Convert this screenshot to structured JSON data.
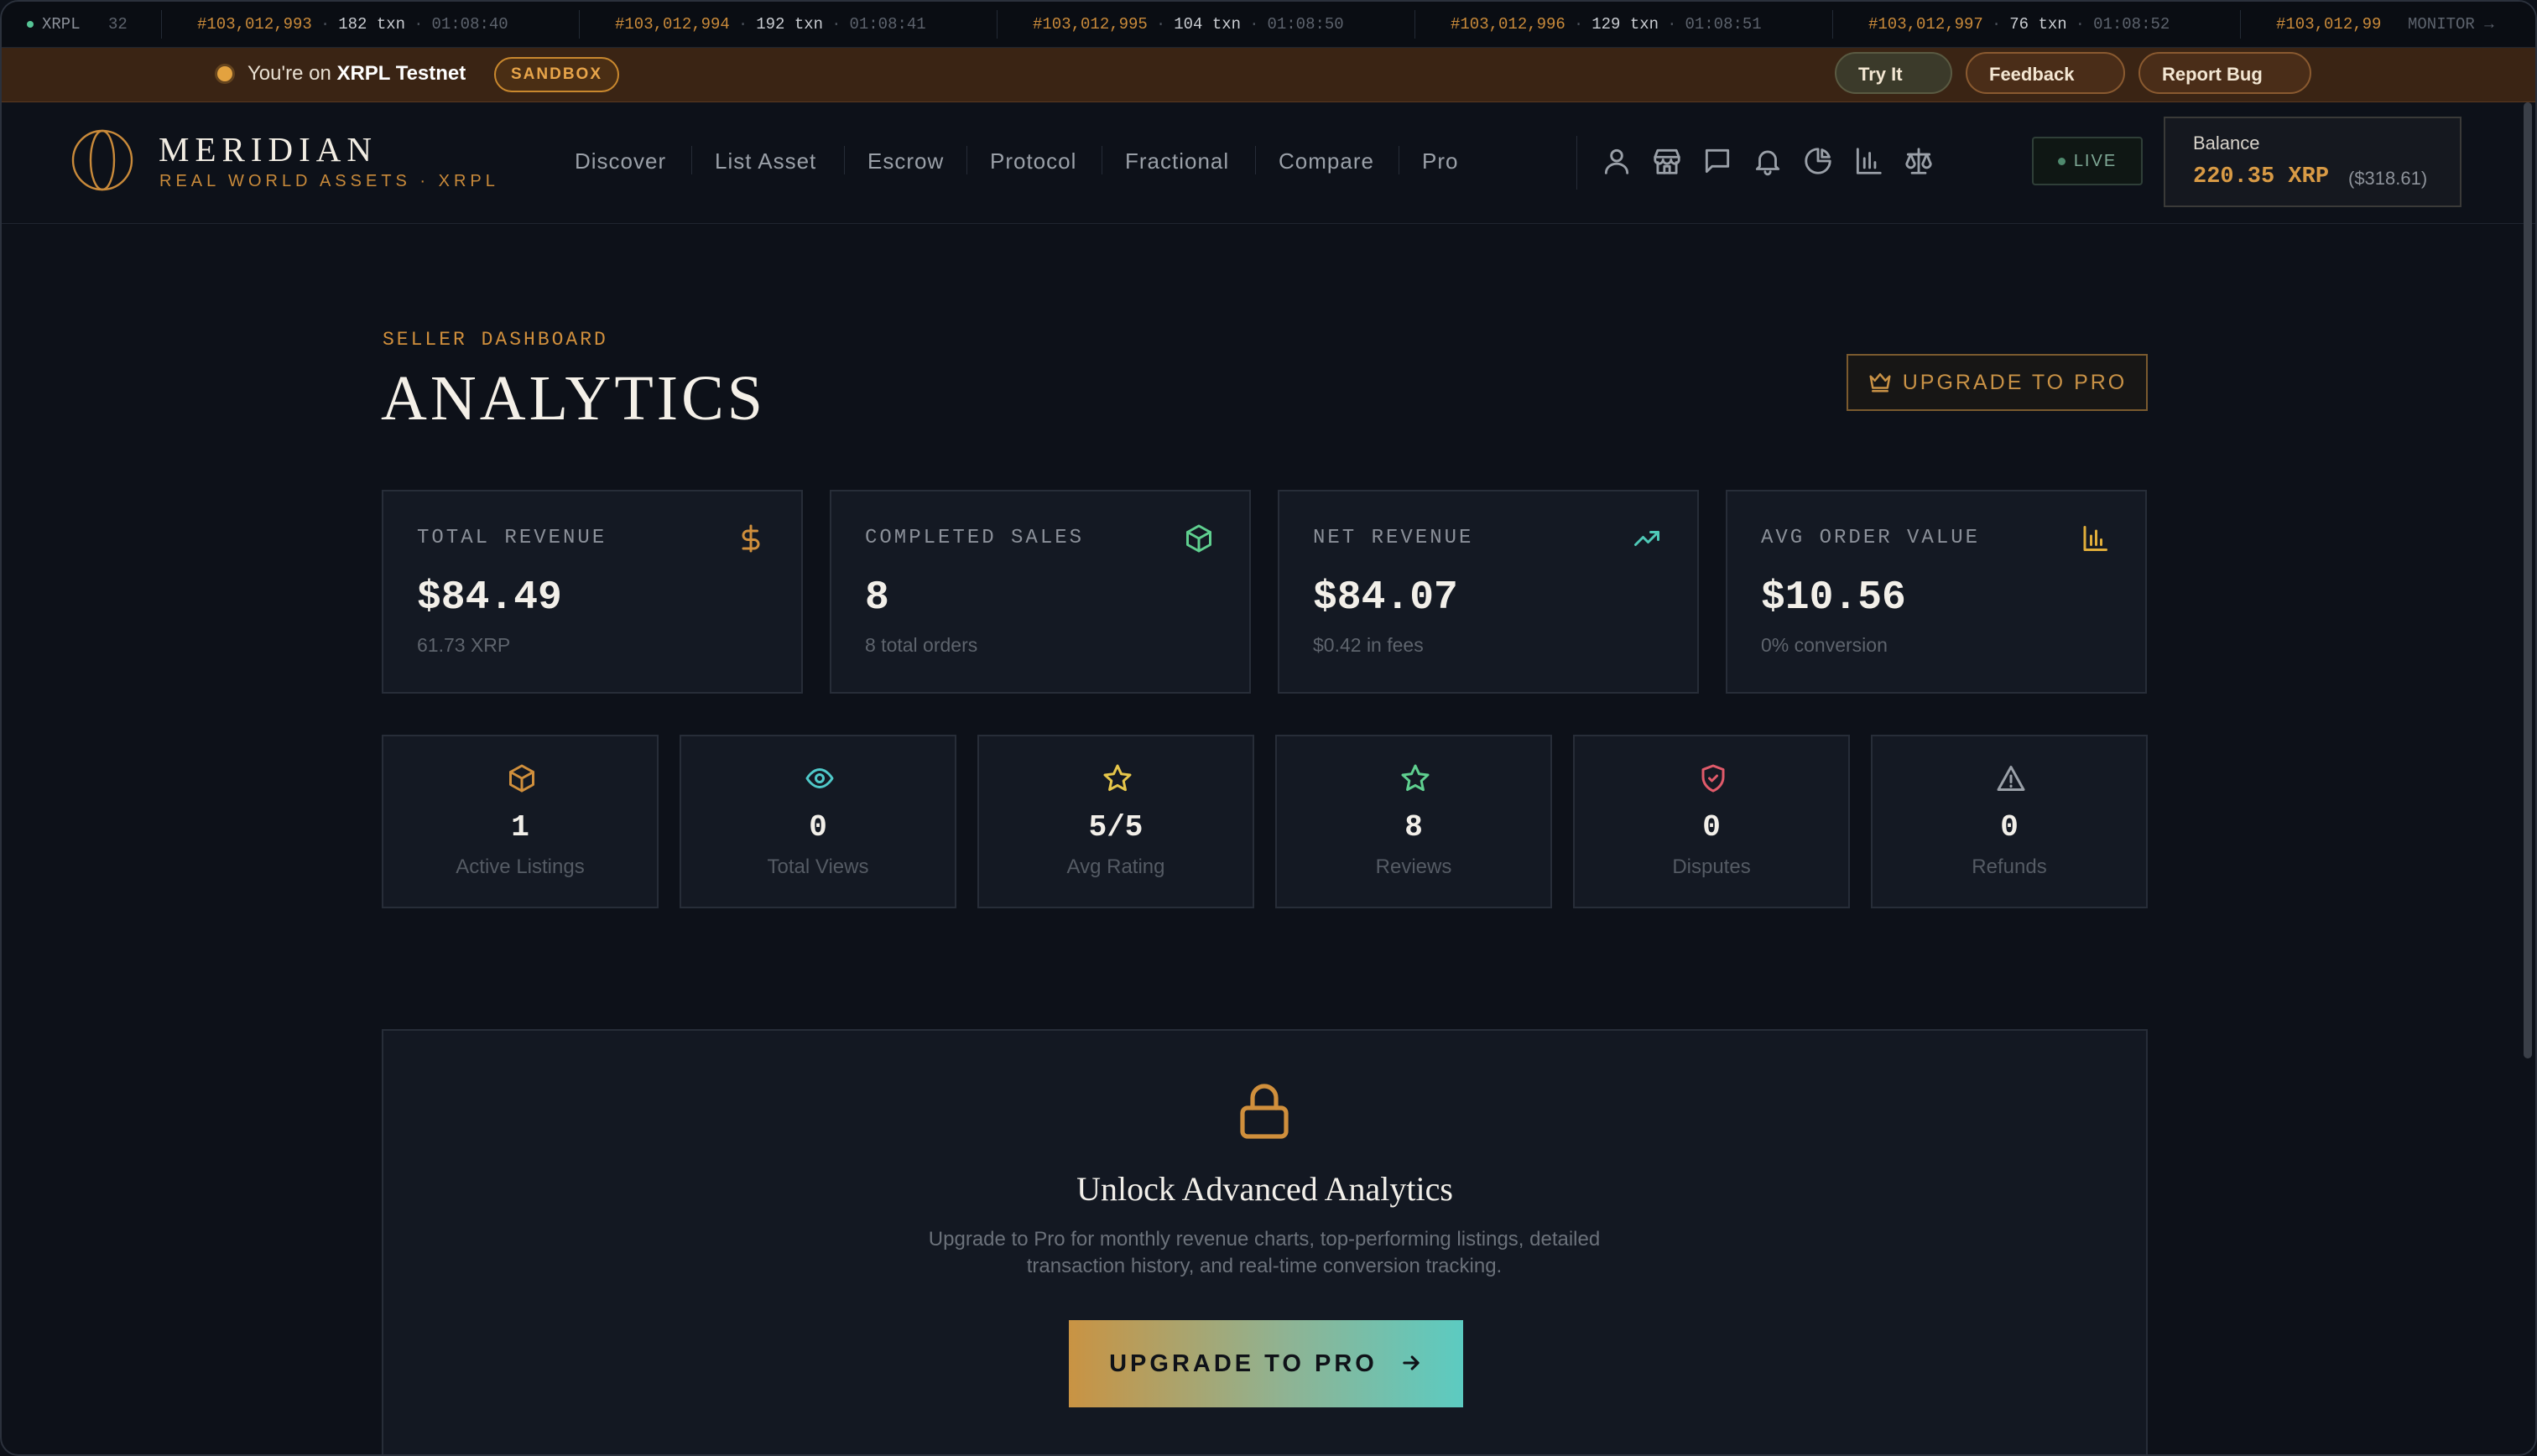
{
  "ticker": {
    "network": "XRPL",
    "partial_left": "32",
    "blocks": [
      {
        "block": "#103,012,993",
        "txn": "182 txn",
        "time": "01:08:40"
      },
      {
        "block": "#103,012,994",
        "txn": "192 txn",
        "time": "01:08:41"
      },
      {
        "block": "#103,012,995",
        "txn": "104 txn",
        "time": "01:08:50"
      },
      {
        "block": "#103,012,996",
        "txn": "129 txn",
        "time": "01:08:51"
      },
      {
        "block": "#103,012,997",
        "txn": "76 txn",
        "time": "01:08:52"
      },
      {
        "block": "#103,012,99"
      }
    ],
    "monitor": "MONITOR →"
  },
  "sandbox": {
    "prefix": "You're on ",
    "network": "XRPL Testnet",
    "badge": "SANDBOX",
    "try_it": "Try It",
    "feedback": "Feedback",
    "report_bug": "Report Bug"
  },
  "header": {
    "brand": "MERIDIAN",
    "brand_sub": "REAL WORLD ASSETS · XRPL",
    "nav": [
      "Discover",
      "List Asset",
      "Escrow",
      "Protocol",
      "Fractional",
      "Compare",
      "Pro"
    ],
    "icons": [
      "user-icon",
      "store-icon",
      "chat-icon",
      "bell-icon",
      "pie-chart-icon",
      "bar-chart-icon",
      "scale-icon"
    ],
    "live": "LIVE",
    "balance_label": "Balance",
    "balance_value": "220.35 XRP",
    "balance_usd": "($318.61)"
  },
  "page": {
    "eyebrow": "SELLER DASHBOARD",
    "title": "ANALYTICS",
    "upgrade_label": "UPGRADE TO PRO"
  },
  "stats": [
    {
      "label": "TOTAL REVENUE",
      "value": "$84.49",
      "sub": "61.73 XRP",
      "icon": "dollar-icon",
      "color": "#d08f3c"
    },
    {
      "label": "COMPLETED SALES",
      "value": "8",
      "sub": "8 total orders",
      "icon": "package-icon",
      "color": "#5fcf8f"
    },
    {
      "label": "NET REVENUE",
      "value": "$84.07",
      "sub": "$0.42 in fees",
      "icon": "trending-up-icon",
      "color": "#4fc9b7"
    },
    {
      "label": "AVG ORDER VALUE",
      "value": "$10.56",
      "sub": "0% conversion",
      "icon": "bar-chart-icon",
      "color": "#e0ad3a"
    }
  ],
  "minis": [
    {
      "value": "1",
      "label": "Active Listings",
      "icon": "package-icon",
      "color": "#d08f3c"
    },
    {
      "value": "0",
      "label": "Total Views",
      "icon": "eye-icon",
      "color": "#4fc9c9"
    },
    {
      "value": "5/5",
      "label": "Avg Rating",
      "icon": "star-icon",
      "color": "#e6c64a"
    },
    {
      "value": "8",
      "label": "Reviews",
      "icon": "star-outline-icon",
      "color": "#5fcf8f"
    },
    {
      "value": "0",
      "label": "Disputes",
      "icon": "shield-icon",
      "color": "#e05a6a"
    },
    {
      "value": "0",
      "label": "Refunds",
      "icon": "alert-triangle-icon",
      "color": "#9aa0a8"
    }
  ],
  "unlock": {
    "title": "Unlock Advanced Analytics",
    "description": "Upgrade to Pro for monthly revenue charts, top-performing listings, detailed transaction history, and real-time conversion tracking.",
    "button": "UPGRADE TO PRO"
  }
}
